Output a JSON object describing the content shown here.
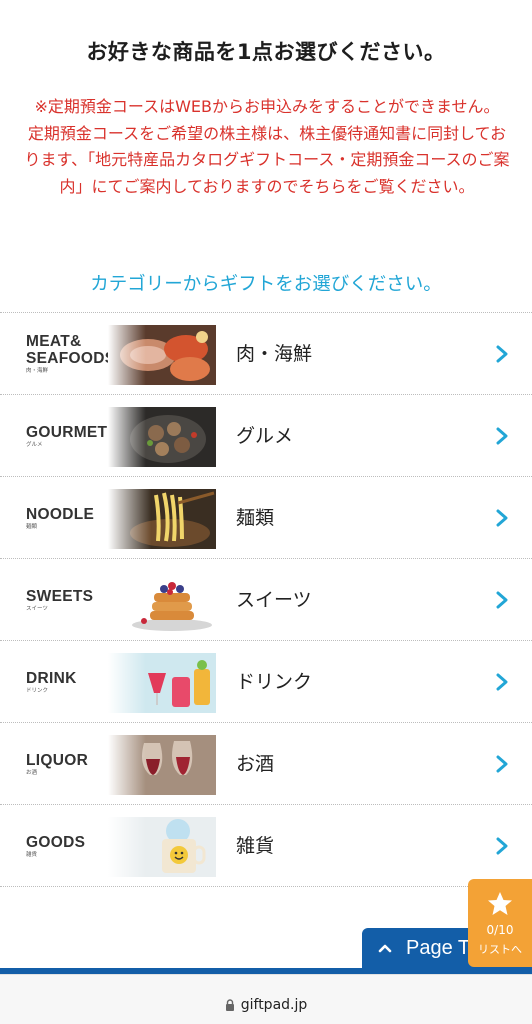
{
  "page": {
    "title": "お好きな商品を1点お選びください。",
    "notice": [
      "※定期預金コースはWEBからお申込みをすることができません。",
      "定期預金コースをご希望の株主様は、株主優待通知書に同封しております、「地元特産品カタログギフトコース・定期預金コースのご案内」にてご案内しておりますのでそちらをご覧ください。"
    ],
    "category_prompt": "カテゴリーからギフトをお選びください。"
  },
  "categories": [
    {
      "brand": "MEAT&\nSEAFOODS",
      "brand_sub": "肉・海鮮",
      "name": "肉・海鮮",
      "icon": "meat-seafood-photo"
    },
    {
      "brand": "GOURMET",
      "brand_sub": "グルメ",
      "name": "グルメ",
      "icon": "gourmet-photo"
    },
    {
      "brand": "NOODLE",
      "brand_sub": "麺類",
      "name": "麺類",
      "icon": "noodle-photo"
    },
    {
      "brand": "SWEETS",
      "brand_sub": "スイーツ",
      "name": "スイーツ",
      "icon": "sweets-photo"
    },
    {
      "brand": "DRINK",
      "brand_sub": "ドリンク",
      "name": "ドリンク",
      "icon": "drink-photo"
    },
    {
      "brand": "LIQUOR",
      "brand_sub": "お酒",
      "name": "お酒",
      "icon": "liquor-photo"
    },
    {
      "brand": "GOODS",
      "brand_sub": "雑貨",
      "name": "雑貨",
      "icon": "goods-photo"
    }
  ],
  "page_top": {
    "label": "Page Top",
    "icon": "chevron-up-icon"
  },
  "wishlist": {
    "count": "0/10",
    "label": "リストへ",
    "icon": "star-icon"
  },
  "browser": {
    "url": "giftpad.jp",
    "icon": "lock-icon"
  },
  "colors": {
    "notice_red": "#d9322c",
    "accent_blue": "#22a6d6",
    "navy": "#135ea8",
    "orange": "#f3a236"
  }
}
